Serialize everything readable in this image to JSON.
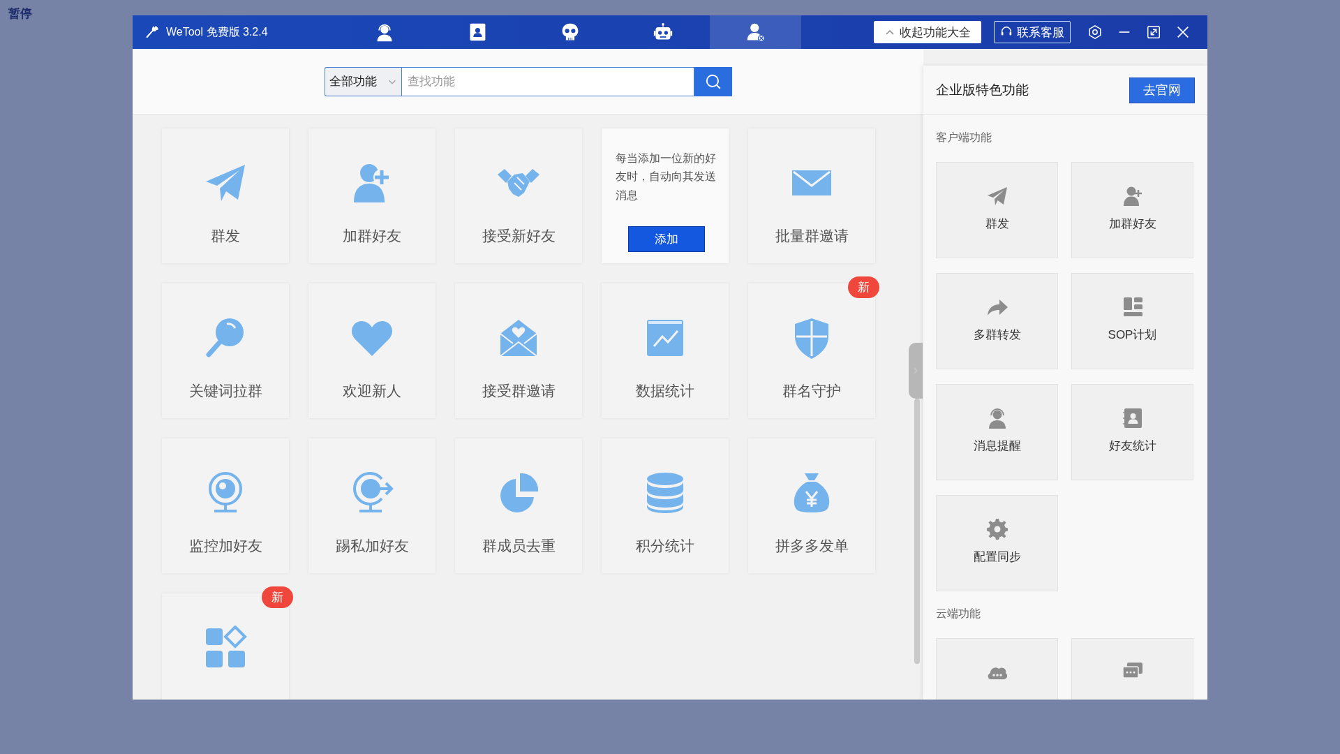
{
  "desktop": {
    "label": "暂停"
  },
  "window": {
    "title": "WeTool 免费版 3.2.4"
  },
  "nav_tabs": [
    {
      "selected": false
    },
    {
      "selected": false
    },
    {
      "selected": false
    },
    {
      "selected": false
    },
    {
      "selected": true
    }
  ],
  "header_buttons": [
    {
      "kind": "collapse",
      "label": "收起功能大全"
    },
    {
      "kind": "contact",
      "label": "联系客服"
    }
  ],
  "search": {
    "category": "全部功能",
    "placeholder": "查找功能"
  },
  "features": [
    {
      "kind": "feature",
      "label": "群发"
    },
    {
      "kind": "feature",
      "label": "加群好友"
    },
    {
      "kind": "feature",
      "label": "接受新好友"
    },
    {
      "kind": "info",
      "text": "每当添加一位新的好友时，自动向其发送消息",
      "button": "添加"
    },
    {
      "kind": "feature",
      "label": "批量群邀请"
    },
    {
      "kind": "feature",
      "label": "关键词拉群"
    },
    {
      "kind": "feature",
      "label": "欢迎新人"
    },
    {
      "kind": "feature",
      "label": "接受群邀请"
    },
    {
      "kind": "feature",
      "label": "数据统计"
    },
    {
      "kind": "feature",
      "label": "群名守护",
      "badge": "新"
    },
    {
      "kind": "feature",
      "label": "监控加好友"
    },
    {
      "kind": "feature",
      "label": "踢私加好友"
    },
    {
      "kind": "feature",
      "label": "群成员去重"
    },
    {
      "kind": "feature",
      "label": "积分统计"
    },
    {
      "kind": "feature",
      "label": "拼多多发单"
    },
    {
      "kind": "cut",
      "badge": "新"
    }
  ],
  "enterprise_panel": {
    "title": "企业版特色功能",
    "button": "去官网",
    "sections": [
      {
        "heading": "客户端功能",
        "cards": [
          {
            "kind": "feature",
            "label": "群发"
          },
          {
            "kind": "feature",
            "label": "加群好友"
          },
          {
            "kind": "feature",
            "label": "多群转发"
          },
          {
            "kind": "feature",
            "label": "SOP计划"
          },
          {
            "kind": "feature",
            "label": "消息提醒"
          },
          {
            "kind": "feature",
            "label": "好友统计"
          },
          {
            "kind": "feature",
            "label": "配置同步"
          }
        ]
      },
      {
        "heading": "云端功能",
        "cards": [
          {
            "kind": "cut"
          },
          {
            "kind": "cut"
          }
        ]
      }
    ]
  }
}
